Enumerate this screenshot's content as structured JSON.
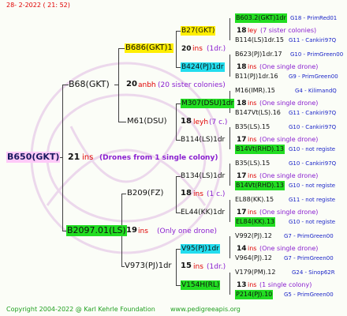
{
  "header": {
    "date": "28-  2-2022 ( 21: 52)"
  },
  "footer": {
    "copyright": "Copyright 2004-2022 @ Karl Kehrle Foundation",
    "site": "www.pedigreeapis.org"
  },
  "root": {
    "name": "B650(GKT)",
    "count": "21",
    "unit": "ins",
    "note": "(Drones from 1 single colony)"
  },
  "gen1": {
    "sire": {
      "name": "B68(GKT)",
      "count": "20",
      "unit": "anbh",
      "note": "(20 sister colonies)"
    },
    "dam": {
      "name": "B2097.01(LS)",
      "count": "19",
      "unit": "ins",
      "note": "(Only one drone)"
    }
  },
  "gen2": {
    "ss": {
      "name": "B686(GKT)1",
      "count": "20",
      "unit": "ins",
      "note": "(1dr.)"
    },
    "sd": {
      "name": "M61(DSU)",
      "count": "18",
      "unit": "leyh",
      "note": "(7 c.)"
    },
    "ds": {
      "name": "B209(FZ)",
      "count": "18",
      "unit": "ins",
      "note": "(1 c.)"
    },
    "dd": {
      "name": "V973(PJ)1dr",
      "count": "15",
      "unit": "ins",
      "note": "(1dr.)"
    }
  },
  "gen3": [
    {
      "name": "B27(GKT)",
      "count": "18",
      "unit": "ley",
      "note": "(7 sister colonies)"
    },
    {
      "name": "B424(PJ)1dr",
      "count": "18",
      "unit": "ins",
      "note": "(One single drone)"
    },
    {
      "name": "M307(DSU)1dr",
      "count": "18",
      "unit": "ins",
      "note": "(One single drone)"
    },
    {
      "name": "B114(LS)1dr",
      "count": "17",
      "unit": "ins",
      "note": "(One single drone)"
    },
    {
      "name": "B134(LS)1dr",
      "count": "17",
      "unit": "ins",
      "note": "(One single drone)"
    },
    {
      "name": "EL44(KK)1dr",
      "count": "17",
      "unit": "ins",
      "note": "(One single drone)"
    },
    {
      "name": "V95(PJ)1dr",
      "count": "14",
      "unit": "ins",
      "note": "(One single drone)"
    },
    {
      "name": "V154H(RL)",
      "count": "13",
      "unit": "ins",
      "note": "(1 single colony)"
    }
  ],
  "gen4": [
    {
      "name": "B603.2(GKT)1dr",
      "ref": "G18 - PrimRed01"
    },
    {
      "name": "B114(LS)1dr.15",
      "ref": "G11 - Cankiri97Q"
    },
    {
      "name": "B623(PJ)1dr.17",
      "ref": "G10 - PrimGreen00"
    },
    {
      "name": "B11(PJ)1dr.16",
      "ref": "G9 - PrimGreen00"
    },
    {
      "name": "M16(IMR).15",
      "ref": "G4 - KilimandQ"
    },
    {
      "name": "B147Vt(LS).16",
      "ref": "G11 - Cankiri97Q"
    },
    {
      "name": "B35(LS).15",
      "ref": "G10 - Cankiri97Q"
    },
    {
      "name": "B14Vt(RHD).13",
      "ref": "G10 - not registe"
    },
    {
      "name": "B35(LS).15",
      "ref": "G10 - Cankiri97Q"
    },
    {
      "name": "B14Vt(RHD).13",
      "ref": "G10 - not registe"
    },
    {
      "name": "EL88(KK).15",
      "ref": "G11 - not registe"
    },
    {
      "name": "EL84(KK).13",
      "ref": "G10 - not registe"
    },
    {
      "name": "V992(PJ).12",
      "ref": "G7 - PrimGreen00"
    },
    {
      "name": "V964(PJ).12",
      "ref": "G7 - PrimGreen00"
    },
    {
      "name": "V179(PM).12",
      "ref": "G24 - Sinop62R"
    },
    {
      "name": "P214(PJ).10",
      "ref": "G5 - PrimGreen00"
    }
  ],
  "colors": {
    "yellow": "#ffee00",
    "green": "#22dd22",
    "cyan": "#22ddee",
    "pink": "#ffcaf8",
    "red": "#e00000",
    "blue": "#1c26c8",
    "purple": "#8a1fd0"
  }
}
